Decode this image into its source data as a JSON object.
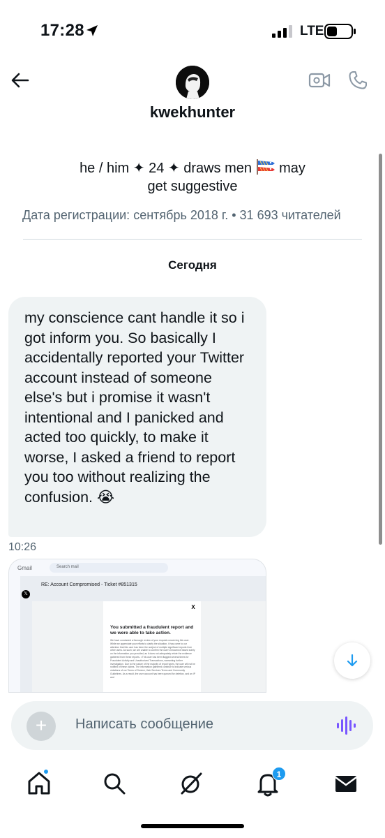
{
  "status_bar": {
    "time": "17:28",
    "network": "LTE",
    "icons": [
      "location-arrow-icon",
      "signal-bars-icon",
      "battery-icon"
    ]
  },
  "header": {
    "username": "kwekhunter",
    "icons": [
      "back-arrow-icon",
      "avatar",
      "video-camera-icon",
      "phone-icon"
    ]
  },
  "profile": {
    "bio_line1_part1": "he / him ✦ 24 ✦ draws men",
    "bio_line1_part2": "may",
    "bio_line2": "get suggestive",
    "bio_emoji": "carp-streamer-emoji",
    "join_info": "Дата регистрации: сентябрь 2018 г. • 31 693 читателей"
  },
  "conversation": {
    "date_separator": "Сегодня",
    "messages": [
      {
        "text": "my conscience cant handle it so i got inform you. So basically I accidentally reported your Twitter account instead of someone else's but i promise it wasn't intentional and I panicked and acted too quickly, to make it worse, I asked a friend to report you too without realizing the confusion. 😭",
        "time": "10:26"
      }
    ],
    "attachment": {
      "app_label": "Gmail",
      "search_placeholder": "Search mail",
      "subject": "RE: Account Compromised - Ticket #851315",
      "logo": "X",
      "heading": "You submitted a fraudulent report and we were able to take action.",
      "body": "We have conducted a thorough review of your request concerning this user. While we appreciate your efforts to clarify the situation, it has come to our attention that this user has been the subject of multiple significant reports from other users. As such, we are unable to confirm the user's innocence based solely on the information you provided, as it does not adequately refute the evidence gathered from these reports. • This user has been flagged several times for Fraudulent Activity and Unauthorized Transactions, warranting further investigation. Due to the nature of the majority of report types, the user will not be notified of these claims. The information gathered continue to indicate serious violations of our Terms of Service, their Services Terms and Community Guidelines. As a result, the user account has been queued for deletion, and an IP and"
    }
  },
  "composer": {
    "placeholder": "Написать сообщение"
  },
  "bottom_nav": {
    "items": [
      "home-icon",
      "search-icon",
      "grok-icon",
      "notifications-icon",
      "messages-icon"
    ],
    "notification_count": "1"
  },
  "colors": {
    "accent": "#1d9bf0",
    "bubble": "#eff3f4",
    "secondary_text": "#536471",
    "voice_icon": "#7856ff"
  }
}
